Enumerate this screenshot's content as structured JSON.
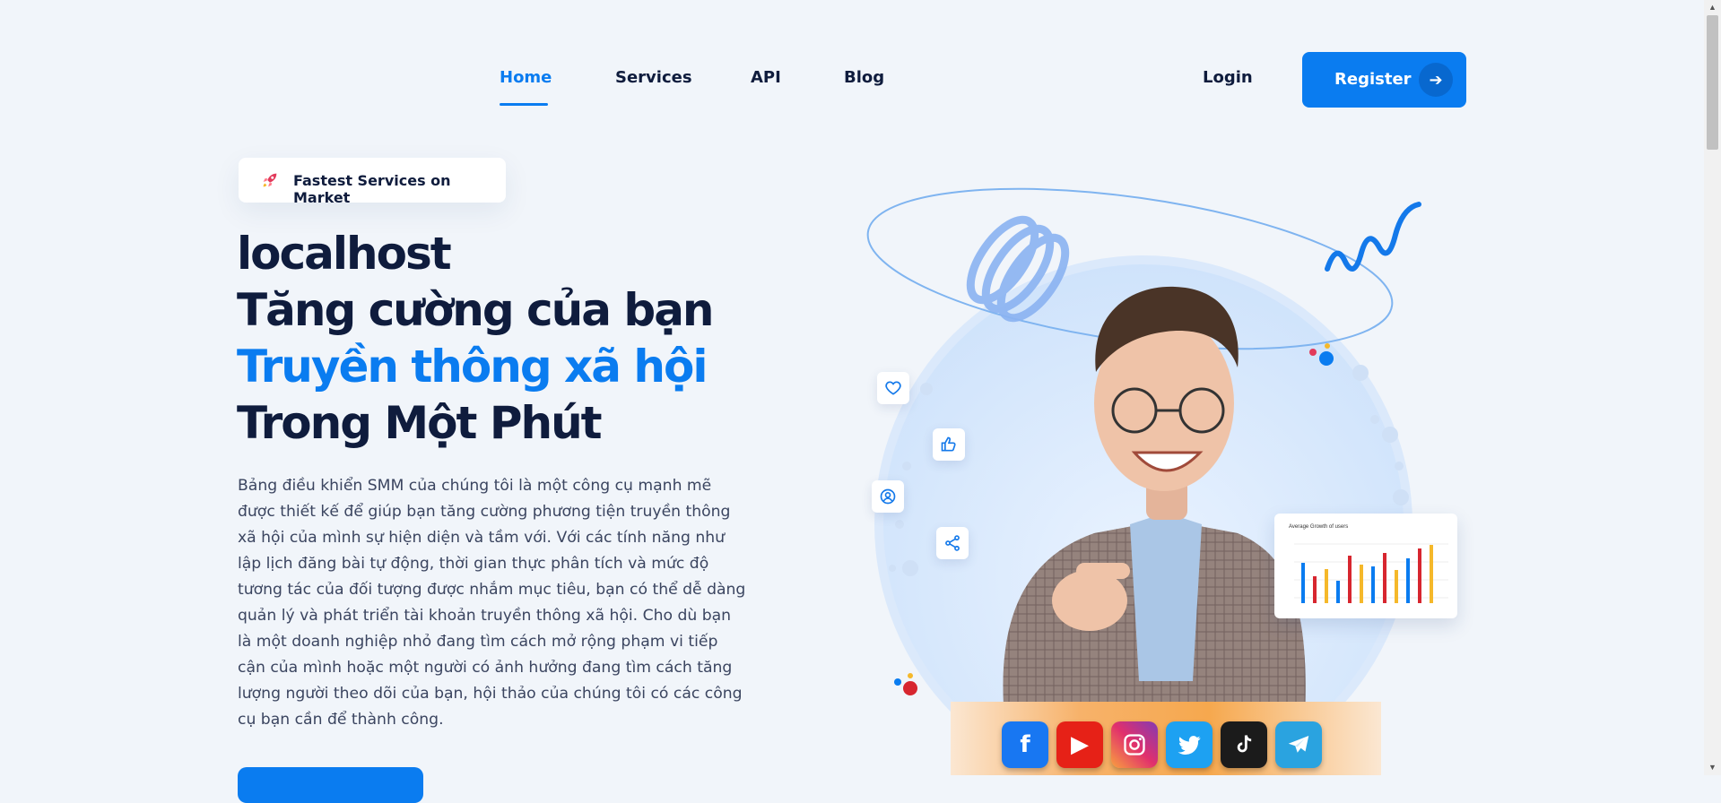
{
  "nav": {
    "links": [
      {
        "label": "Home",
        "active": true
      },
      {
        "label": "Services",
        "active": false
      },
      {
        "label": "API",
        "active": false
      },
      {
        "label": "Blog",
        "active": false
      }
    ],
    "login_label": "Login",
    "register_label": "Register",
    "register_icon": "arrow-right-icon"
  },
  "hero": {
    "badge_icon": "rocket-icon",
    "badge_text": "Fastest Services on Market",
    "headline": [
      "localhost",
      "Tăng cường của bạn",
      "Truyền thông xã hội",
      "Trong Một Phút"
    ],
    "description": "Bảng điều khiển SMM của chúng tôi là một công cụ mạnh mẽ được thiết kế để giúp bạn tăng cường phương tiện truyền thông xã hội của mình sự hiện diện và tầm với. Với các tính năng như lập lịch đăng bài tự động, thời gian thực phân tích và mức độ tương tác của đối tượng được nhắm mục tiêu, bạn có thể dễ dàng quản lý và phát triển tài khoản truyền thông xã hội. Cho dù bạn là một doanh nghiệp nhỏ đang tìm cách mở rộng phạm vi tiếp cận của mình hoặc một người có ảnh hưởng đang tìm cách tăng lượng người theo dõi của bạn, hội thảo của chúng tôi có các công cụ bạn cần để thành công.",
    "chips": [
      "heart-icon",
      "thumbs-up-icon",
      "user-plus-icon",
      "share-icon"
    ],
    "chart_card_title": "Average Growth of users",
    "social_icons": [
      "facebook-icon",
      "youtube-icon",
      "instagram-icon",
      "twitter-icon",
      "tiktok-icon",
      "telegram-icon"
    ],
    "colors": {
      "accent": "#0a7cf0",
      "dark": "#0f1c3d",
      "red": "#d7262f",
      "yellow": "#f5b82a"
    }
  }
}
